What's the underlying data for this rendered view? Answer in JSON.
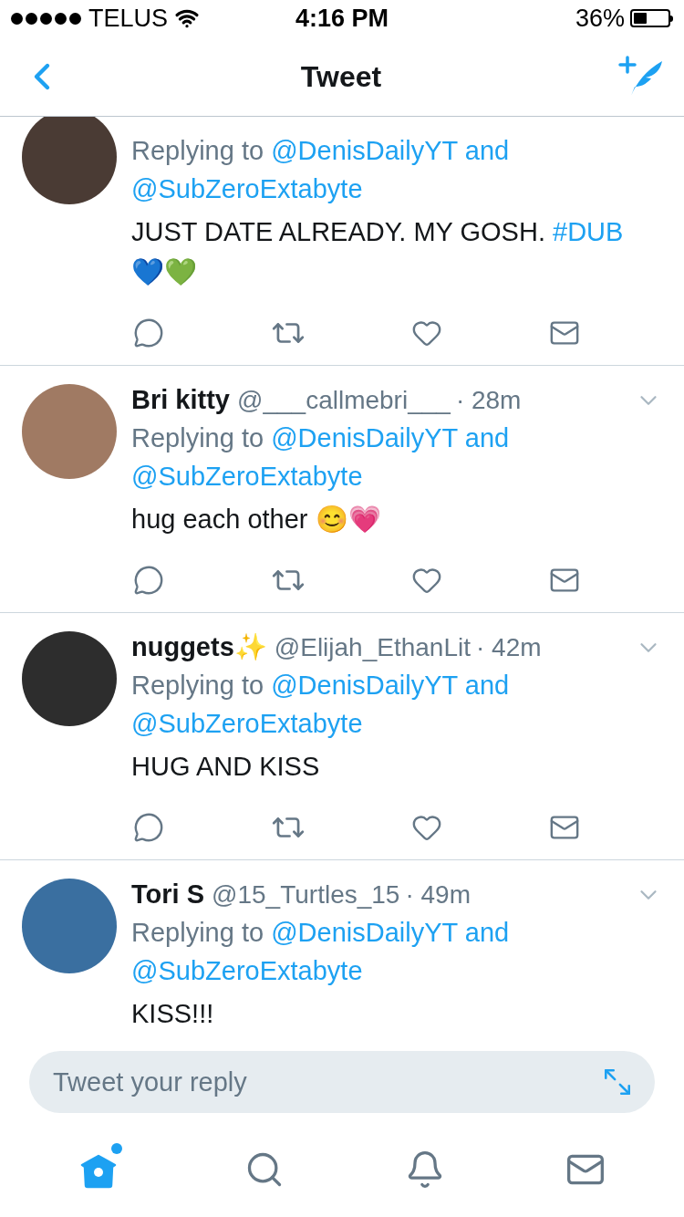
{
  "status_bar": {
    "carrier": "TELUS",
    "time": "4:16 PM",
    "battery": "36%"
  },
  "nav": {
    "title": "Tweet"
  },
  "tweets": [
    {
      "reply_prefix": "Replying to",
      "reply_links": [
        "@DenisDailyYT and",
        "@SubZeroExtabyte"
      ],
      "body": [
        {
          "kind": "plain",
          "text": "JUST DATE ALREADY. MY GOSH. "
        },
        {
          "kind": "hashtag",
          "text": "#DUB"
        },
        {
          "kind": "plain",
          "text": " 💙💚"
        }
      ],
      "actions": true
    },
    {
      "name": "Bri kitty",
      "handle": "@___callmebri___",
      "time": "· 28m",
      "reply_prefix": "Replying to",
      "reply_links": [
        "@DenisDailyYT and",
        "@SubZeroExtabyte"
      ],
      "body": [
        {
          "kind": "plain",
          "text": "hug each other 😊💗"
        }
      ],
      "actions": true
    },
    {
      "name": "nuggets✨",
      "handle": "@Elijah_EthanLit",
      "time": "· 42m",
      "reply_prefix": "Replying to",
      "reply_links": [
        "@DenisDailyYT and",
        "@SubZeroExtabyte"
      ],
      "body": [
        {
          "kind": "plain",
          "text": "HUG AND KISS"
        }
      ],
      "actions": true
    },
    {
      "name": "Tori S",
      "handle": "@15_Turtles_15",
      "time": "· 49m",
      "reply_prefix": "Replying to",
      "reply_links": [
        "@DenisDailyYT and",
        "@SubZeroExtabyte"
      ],
      "body": [
        {
          "kind": "plain",
          "text": "KISS!!!"
        }
      ],
      "actions": false
    }
  ],
  "reply_box": {
    "placeholder": "Tweet your reply"
  },
  "tab_bar": [
    {
      "kind": "home",
      "selected": true,
      "dot": true
    },
    {
      "kind": "search",
      "selected": false
    },
    {
      "kind": "notifications",
      "selected": false
    },
    {
      "kind": "messages",
      "selected": false
    }
  ]
}
